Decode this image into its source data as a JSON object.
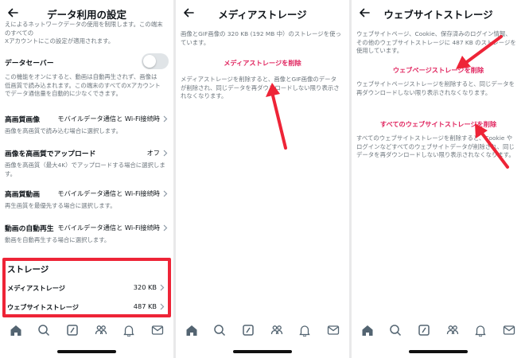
{
  "panel1": {
    "title": "データ利用の設定",
    "top_text_1": "えによるネットワークデータの使用を制限します。この端末のすべての",
    "top_text_2": "Xアカウントにこの設定が適用されます。",
    "data_saver": {
      "label": "データセーバー",
      "desc": "この機能をオンにすると、動画は自動再生されず、画像は低画質で読み込まれます。この端末のすべてのXアカウントでデータ通信量を自動的に少なくできます。"
    },
    "settings": [
      {
        "label": "高画質画像",
        "value": "モバイルデータ通信と Wi-Fi接続時",
        "desc": "画像を高画質で読み込む場合に選択します。"
      },
      {
        "label": "画像を高画質でアップロード",
        "value": "オフ",
        "desc": "画像を高画質（最大4K）でアップロードする場合に選択します。"
      },
      {
        "label": "高画質動画",
        "value": "モバイルデータ通信と Wi-Fi接続時",
        "desc": "再生画質を最優先する場合に選択します。"
      },
      {
        "label": "動画の自動再生",
        "value": "モバイルデータ通信と Wi-Fi接続時",
        "desc": "動画を自動再生する場合に選択します。"
      }
    ],
    "storage": {
      "heading": "ストレージ",
      "items": [
        {
          "label": "メディアストレージ",
          "value": "320 KB"
        },
        {
          "label": "ウェブサイトストレージ",
          "value": "487 KB"
        }
      ]
    }
  },
  "panel2": {
    "title": "メディアストレージ",
    "top_text": "画像とGIF画像の 320 KB (192 MB 中）のストレージを使っています。",
    "action": "メディアストレージを削除",
    "desc": "メディアストレージを削除すると、画像とGIF画像のデータが削除され、同じデータを再ダウンロードしない限り表示されなくなります。"
  },
  "panel3": {
    "title": "ウェブサイトストレージ",
    "top_text": "ウェブサイトページ、Cookie、保存済みのログイン情報、その他のウェブサイトストレージに 487 KB のストレージを使用しています。",
    "action1": "ウェブページストレージを削除",
    "desc1": "ウェブサイトページストレージを削除すると、同じデータを再ダウンロードしない限り表示されなくなります。",
    "action2": "すべてのウェブサイトストレージを削除",
    "desc2": "すべてのウェブサイトストレージを削除すると、Cookie やログインなどすべてのウェブサイトデータが削除され、同じデータを再ダウンロードしない限り表示されなくなります。"
  },
  "nav_icons": [
    "home-icon",
    "search-icon",
    "compose-icon",
    "communities-icon",
    "notifications-icon",
    "messages-icon"
  ],
  "colors": {
    "highlight": "#ee2437",
    "action_text": "#e0245e",
    "toggle_off": "#e0e4e7",
    "text_secondary": "#6d767d"
  }
}
